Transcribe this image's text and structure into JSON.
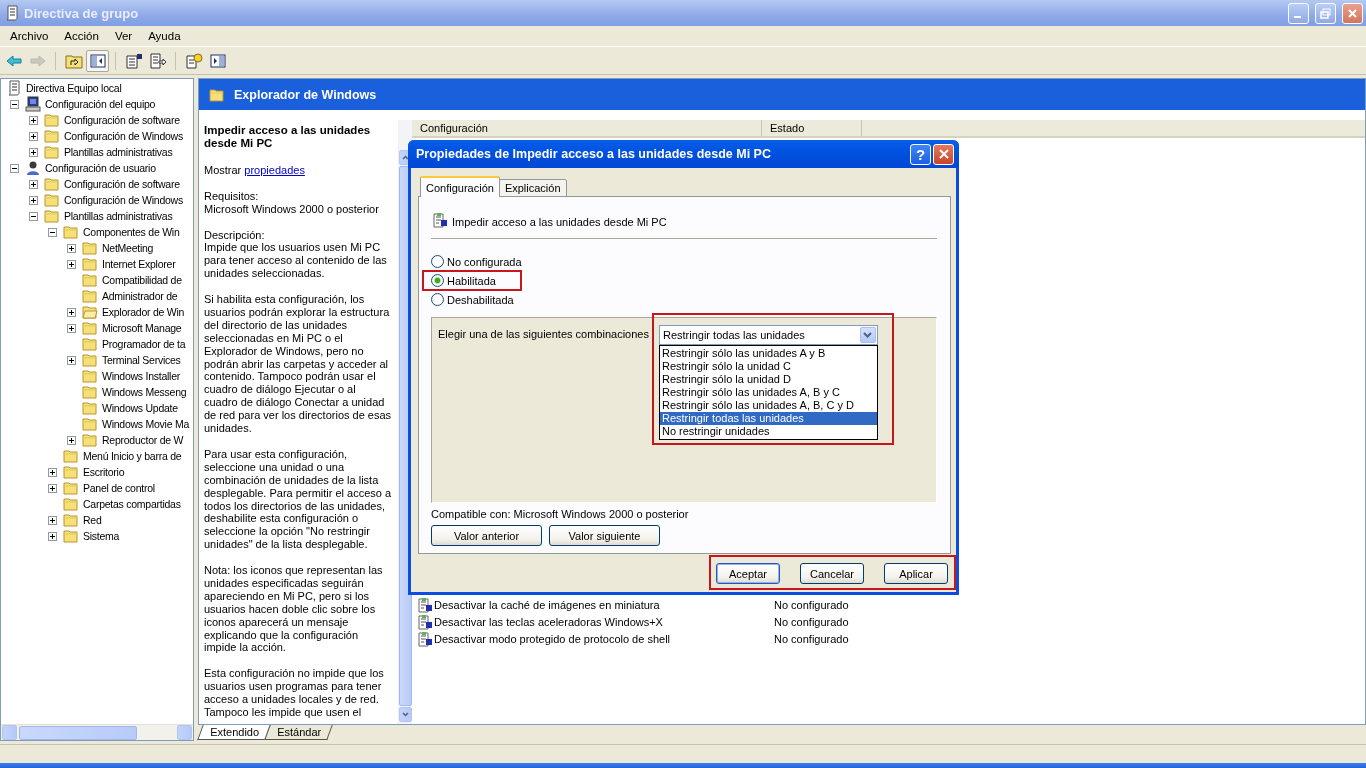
{
  "window": {
    "title": "Directiva de grupo"
  },
  "menu": [
    "Archivo",
    "Acción",
    "Ver",
    "Ayuda"
  ],
  "toolbar": [
    {
      "kind": "back",
      "disabled": false,
      "pressed": false
    },
    {
      "kind": "forward",
      "disabled": true,
      "pressed": false
    },
    {
      "kind": "separator"
    },
    {
      "kind": "up",
      "disabled": false,
      "pressed": false
    },
    {
      "kind": "tree",
      "disabled": false,
      "pressed": true
    },
    {
      "kind": "separator"
    },
    {
      "kind": "properties",
      "disabled": false,
      "pressed": false
    },
    {
      "kind": "export",
      "disabled": false,
      "pressed": false
    },
    {
      "kind": "separator"
    },
    {
      "kind": "help",
      "disabled": false,
      "pressed": false
    },
    {
      "kind": "actions",
      "disabled": false,
      "pressed": false
    }
  ],
  "tree": [
    {
      "label": "Directiva Equipo local",
      "kind": "policy",
      "children": [
        {
          "label": "Configuración del equipo",
          "kind": "computer",
          "expanded": true,
          "children": [
            {
              "label": "Configuración de software",
              "kind": "folder",
              "expanded": false
            },
            {
              "label": "Configuración de Windows",
              "kind": "folder",
              "expanded": false
            },
            {
              "label": "Plantillas administrativas",
              "kind": "folder",
              "expanded": false
            }
          ]
        },
        {
          "label": "Configuración de usuario",
          "kind": "user",
          "expanded": true,
          "children": [
            {
              "label": "Configuración de software",
              "kind": "folder",
              "expanded": false
            },
            {
              "label": "Configuración de Windows",
              "kind": "folder",
              "expanded": false
            },
            {
              "label": "Plantillas administrativas",
              "kind": "folder",
              "expanded": true,
              "children": [
                {
                  "label": "Componentes de Win",
                  "kind": "folder",
                  "expanded": true,
                  "children": [
                    {
                      "label": "NetMeeting",
                      "kind": "folder",
                      "expanded": false
                    },
                    {
                      "label": "Internet Explorer",
                      "kind": "folder",
                      "expanded": false
                    },
                    {
                      "label": "Compatibilidad de",
                      "kind": "folder"
                    },
                    {
                      "label": "Administrador de",
                      "kind": "folder"
                    },
                    {
                      "label": "Explorador de Win",
                      "kind": "folder-open",
                      "expanded": false
                    },
                    {
                      "label": "Microsoft Manage",
                      "kind": "folder",
                      "expanded": false
                    },
                    {
                      "label": "Programador de ta",
                      "kind": "folder"
                    },
                    {
                      "label": "Terminal Services",
                      "kind": "folder",
                      "expanded": false
                    },
                    {
                      "label": "Windows Installer",
                      "kind": "folder"
                    },
                    {
                      "label": "Windows Messeng",
                      "kind": "folder"
                    },
                    {
                      "label": "Windows Update",
                      "kind": "folder"
                    },
                    {
                      "label": "Windows Movie Ma",
                      "kind": "folder"
                    },
                    {
                      "label": "Reproductor de W",
                      "kind": "folder",
                      "expanded": false
                    }
                  ]
                },
                {
                  "label": "Menú Inicio y barra de",
                  "kind": "folder"
                },
                {
                  "label": "Escritorio",
                  "kind": "folder",
                  "expanded": false
                },
                {
                  "label": "Panel de control",
                  "kind": "folder",
                  "expanded": false
                },
                {
                  "label": "Carpetas compartidas",
                  "kind": "folder"
                },
                {
                  "label": "Red",
                  "kind": "folder",
                  "expanded": false
                },
                {
                  "label": "Sistema",
                  "kind": "folder",
                  "expanded": false
                }
              ]
            }
          ]
        }
      ]
    }
  ],
  "header": {
    "title": "Explorador de Windows"
  },
  "description": {
    "title": "Impedir acceso a las unidades desde Mi PC",
    "show_label": "Mostrar",
    "show_link": "propiedades",
    "paragraphs": [
      "Requisitos:\nMicrosoft Windows 2000 o posterior",
      "Descripción:\nImpide que los usuarios usen Mi PC para tener acceso al contenido de las unidades seleccionadas.",
      "Si habilita esta configuración, los usuarios podrán explorar la estructura del directorio de las unidades seleccionadas en Mi PC o el Explorador de Windows, pero no podrán abrir las carpetas y acceder al contenido. Tampoco podrán usar el cuadro de diálogo Ejecutar o al cuadro de diálogo Conectar a unidad de red para ver los directorios de esas unidades.",
      "Para usar esta configuración, seleccione una unidad o una combinación de unidades de la lista desplegable. Para permitir el acceso a todos los directorios de las unidades, deshabilite esta configuración o seleccione la opción \"No restringir unidades\" de la lista desplegable.",
      "Nota: los iconos que representan las unidades especificadas seguirán apareciendo en Mi PC, pero si los usuarios hacen doble clic sobre los iconos aparecerá un mensaje explicando que la configuración impide la acción.",
      "Esta configuración no impide que los usuarios usen programas para tener acceso a unidades locales y de red. Tampoco les impide que usen el"
    ]
  },
  "list": {
    "columns": [
      "Configuración",
      "Estado"
    ],
    "rows": [
      {
        "name": "Desactivar la caché de imágenes en miniatura",
        "state": "No configurado"
      },
      {
        "name": "Desactivar las teclas aceleradoras Windows+X",
        "state": "No configurado"
      },
      {
        "name": "Desactivar modo protegido de protocolo de shell",
        "state": "No configurado"
      }
    ]
  },
  "view_tabs": [
    {
      "label": "Extendido",
      "selected": true
    },
    {
      "label": "Estándar",
      "selected": false
    }
  ],
  "dialog": {
    "title": "Propiedades de Impedir acceso a las unidades desde Mi PC",
    "help_label": "?",
    "tabs": [
      {
        "label": "Configuración",
        "selected": true
      },
      {
        "label": "Explicación",
        "selected": false
      }
    ],
    "setting_title": "Impedir acceso a las unidades desde Mi PC",
    "options": [
      {
        "label": "No configurada",
        "selected": false,
        "highlighted": false
      },
      {
        "label": "Habilitada",
        "selected": true,
        "highlighted": true
      },
      {
        "label": "Deshabilitada",
        "selected": false,
        "highlighted": false
      }
    ],
    "combination": {
      "label": "Elegir una de las siguientes combinaciones",
      "value": "Restringir todas las unidades",
      "expanded": true,
      "highlighted": true,
      "options": [
        {
          "label": "Restringir sólo las unidades A y B",
          "selected": false
        },
        {
          "label": "Restringir sólo la unidad C",
          "selected": false
        },
        {
          "label": "Restringir sólo la unidad D",
          "selected": false
        },
        {
          "label": "Restringir sólo las unidades A, B y C",
          "selected": false
        },
        {
          "label": "Restringir sólo las unidades A, B, C y D",
          "selected": false
        },
        {
          "label": "Restringir todas las unidades",
          "selected": true
        },
        {
          "label": "No restringir unidades",
          "selected": false
        }
      ]
    },
    "compatible": "Compatible con: Microsoft Windows 2000 o posterior",
    "nav_buttons": [
      "Valor anterior",
      "Valor siguiente"
    ],
    "footer": {
      "highlighted": true,
      "buttons": [
        {
          "label": "Aceptar",
          "default": true
        },
        {
          "label": "Cancelar",
          "default": false
        },
        {
          "label": "Aplicar",
          "default": false
        }
      ]
    }
  }
}
